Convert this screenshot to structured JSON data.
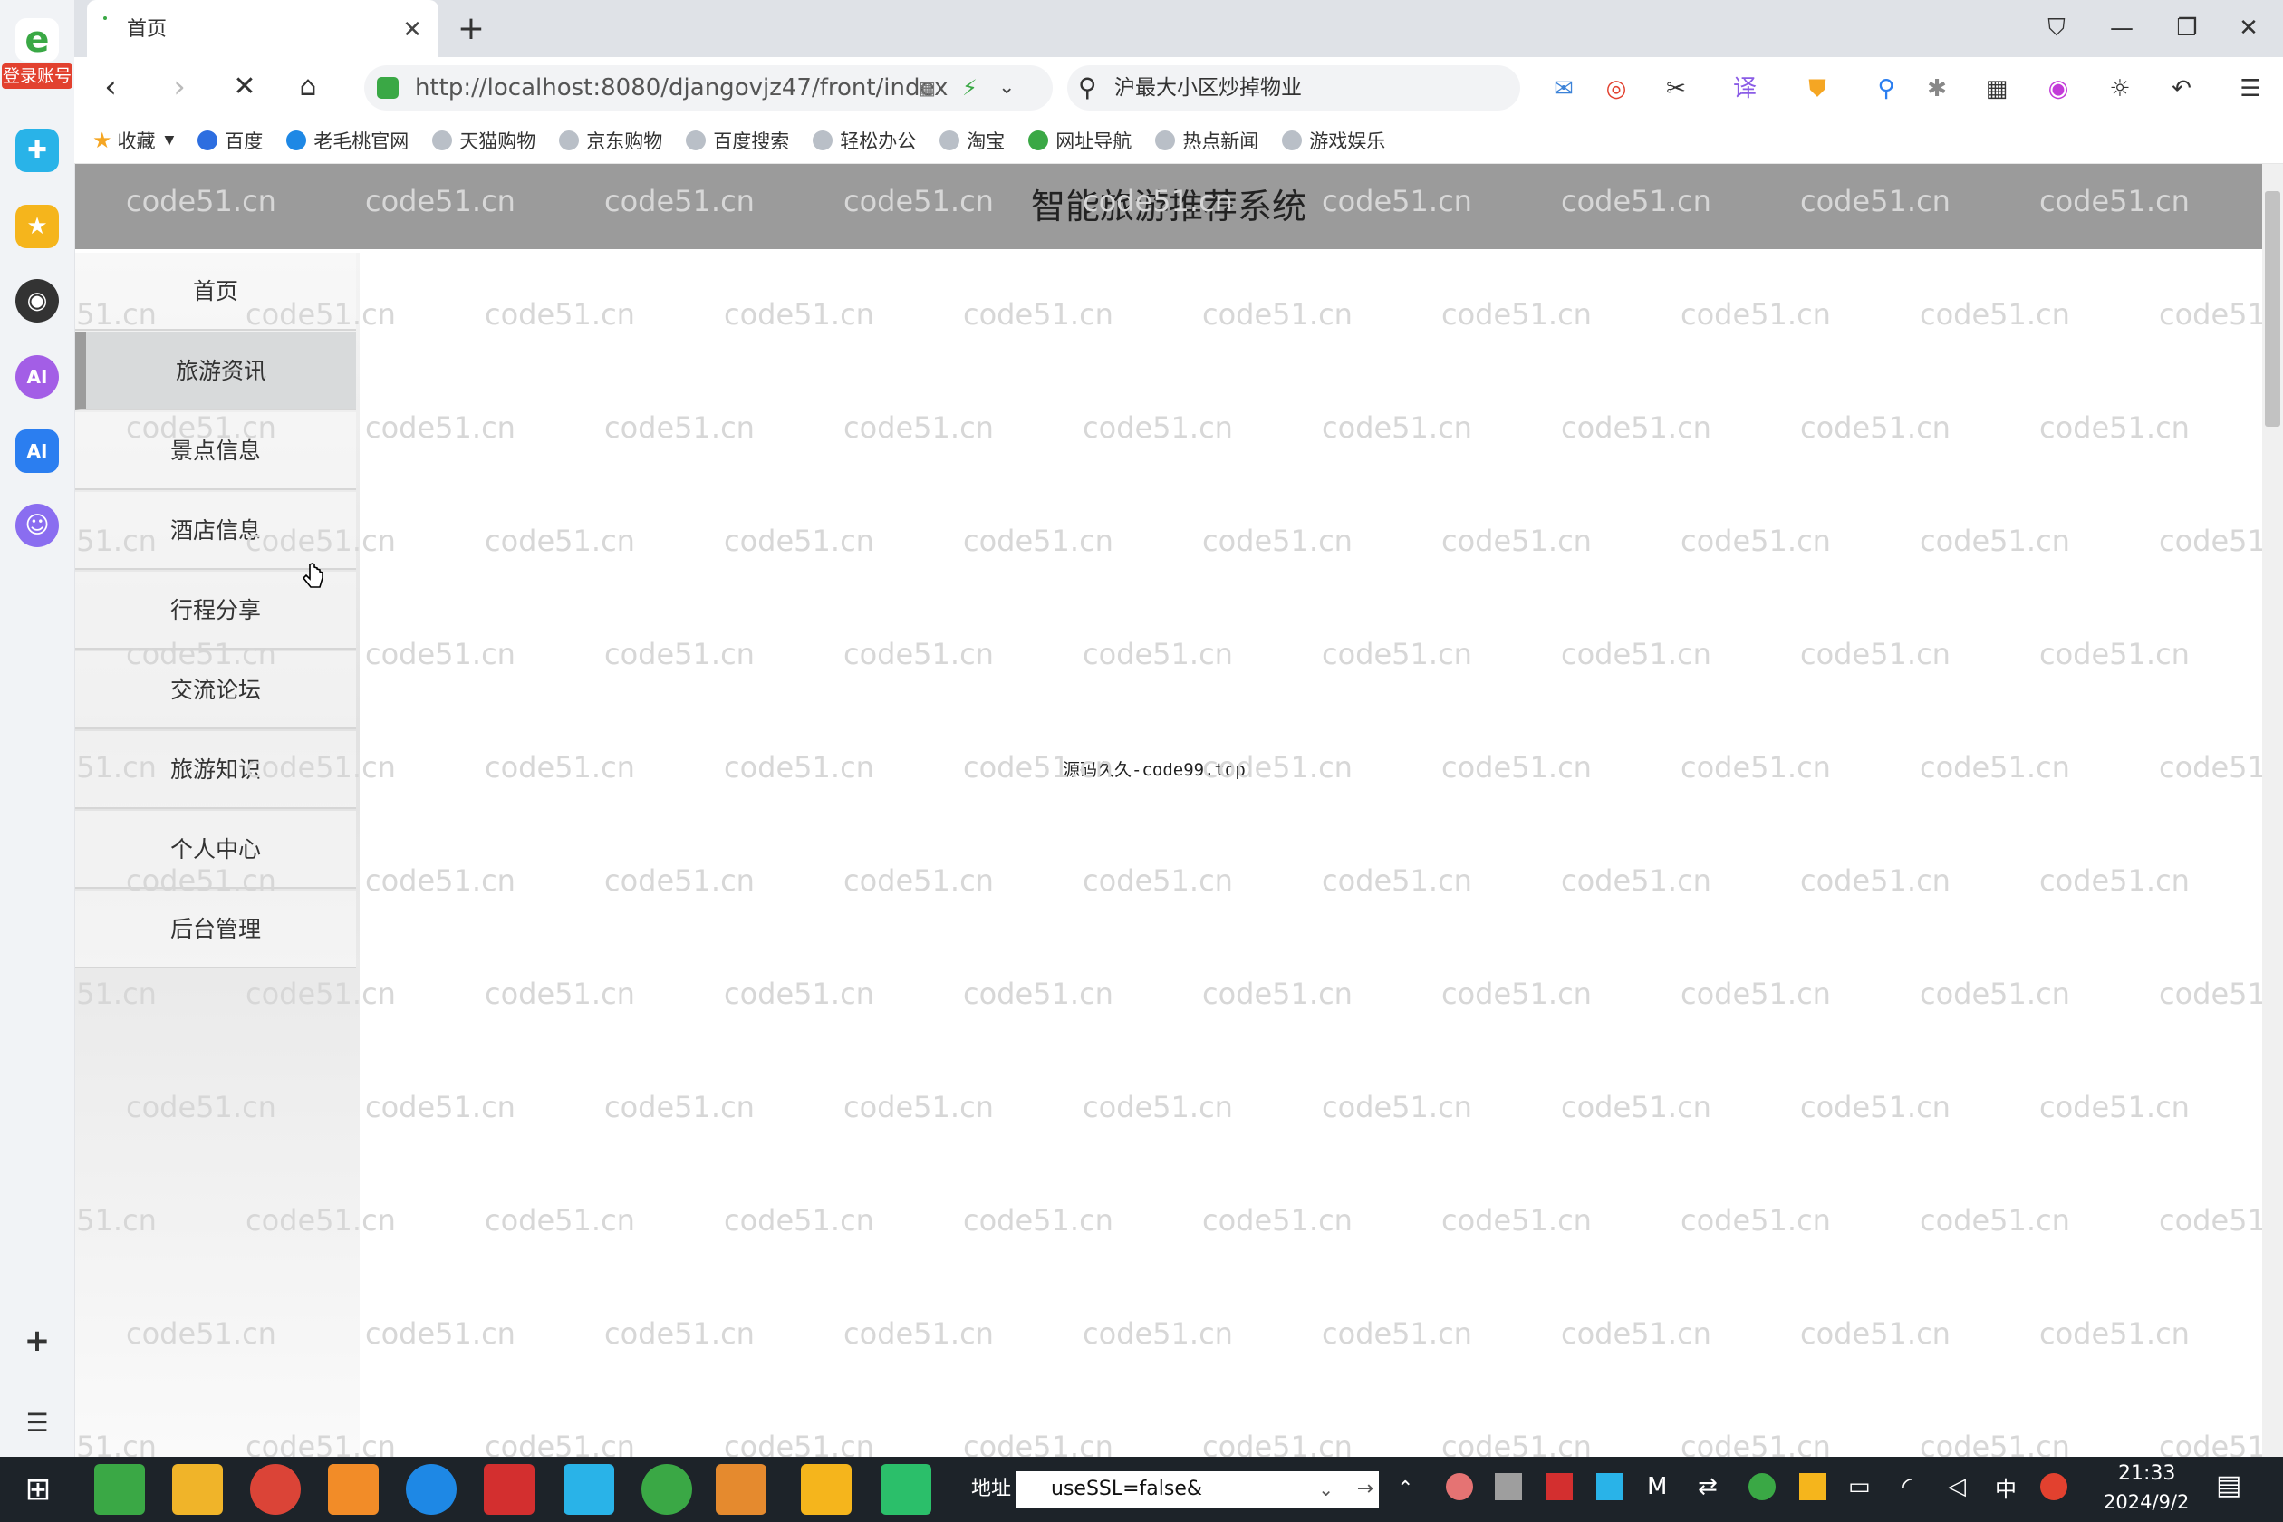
{
  "browser": {
    "tab_title": "首页",
    "tab_close": "✕",
    "new_tab": "+",
    "url": "http://localhost:8080/djangovjz47/front/index",
    "search_text": "沪最大小区炒掉物业",
    "login_badge": "登录账号"
  },
  "bookmarks": [
    {
      "label": "收藏"
    },
    {
      "label": "百度"
    },
    {
      "label": "老毛桃官网"
    },
    {
      "label": "天猫购物"
    },
    {
      "label": "京东购物"
    },
    {
      "label": "百度搜索"
    },
    {
      "label": "轻松办公"
    },
    {
      "label": "淘宝"
    },
    {
      "label": "网址导航"
    },
    {
      "label": "热点新闻"
    },
    {
      "label": "游戏娱乐"
    }
  ],
  "site": {
    "title": "智能旅游推荐系统",
    "center_text": "源码久久-code99.top",
    "watermark": "code51.cn"
  },
  "sidebar": {
    "items": [
      {
        "label": "首页"
      },
      {
        "label": "旅游资讯"
      },
      {
        "label": "景点信息"
      },
      {
        "label": "酒店信息"
      },
      {
        "label": "行程分享"
      },
      {
        "label": "交流论坛"
      },
      {
        "label": "旅游知识"
      },
      {
        "label": "个人中心"
      },
      {
        "label": "后台管理"
      }
    ]
  },
  "taskbar": {
    "address_label": "地址",
    "address_value": "useSSL=false&",
    "time": "21:33",
    "date": "2024/9/2",
    "ime": "中"
  }
}
